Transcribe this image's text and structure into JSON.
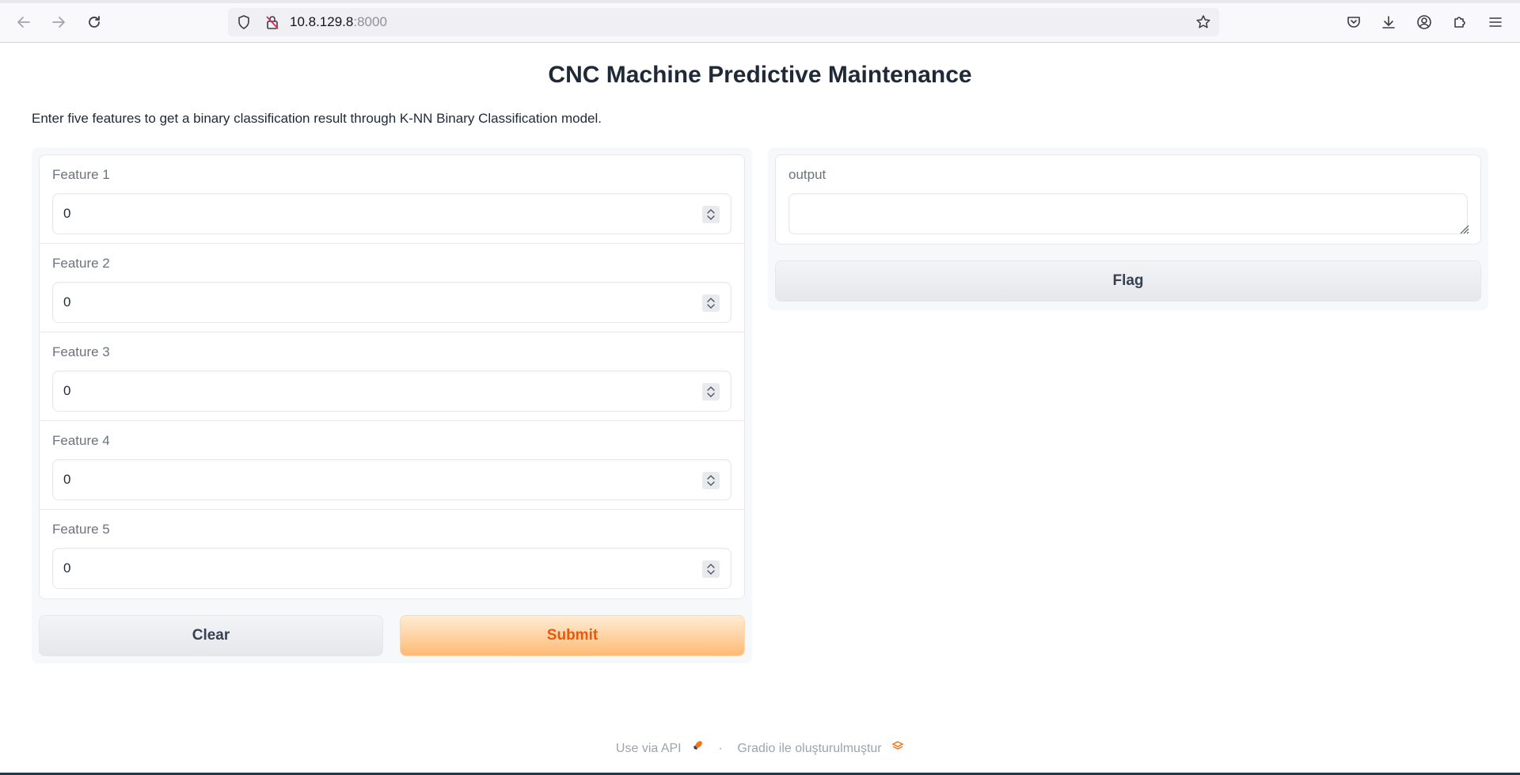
{
  "browser": {
    "url_host": "10.8.129.8",
    "url_port": ":8000"
  },
  "app": {
    "title": "CNC Machine Predictive Maintenance",
    "description": "Enter five features to get a binary classification result through K-NN Binary Classification model."
  },
  "inputs": [
    {
      "label": "Feature 1",
      "value": "0"
    },
    {
      "label": "Feature 2",
      "value": "0"
    },
    {
      "label": "Feature 3",
      "value": "0"
    },
    {
      "label": "Feature 4",
      "value": "0"
    },
    {
      "label": "Feature 5",
      "value": "0"
    }
  ],
  "buttons": {
    "clear": "Clear",
    "submit": "Submit",
    "flag": "Flag"
  },
  "output": {
    "label": "output",
    "value": ""
  },
  "footer": {
    "api_link": "Use via API",
    "separator": "·",
    "built_with": "Gradio ile oluşturulmuştur"
  },
  "colors": {
    "accent": "#ea580c",
    "submit_bg": "#fdba74"
  }
}
